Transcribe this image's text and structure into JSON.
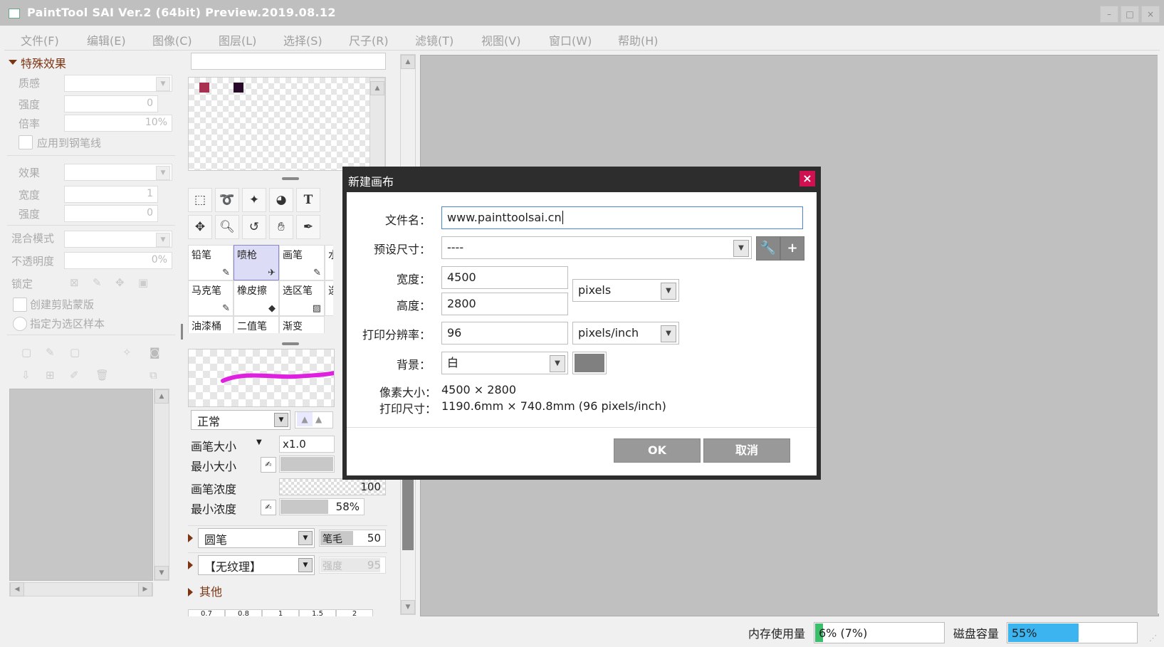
{
  "window": {
    "title": "PaintTool SAI Ver.2 (64bit) Preview.2019.08.12"
  },
  "menu": [
    "文件(F)",
    "编辑(E)",
    "图像(C)",
    "图层(L)",
    "选择(S)",
    "尺子(R)",
    "滤镜(T)",
    "视图(V)",
    "窗口(W)",
    "帮助(H)"
  ],
  "effects_panel": {
    "header": "特殊效果",
    "texture_label": "质感",
    "strength_label": "强度",
    "strength_value": "0",
    "ratio_label": "倍率",
    "ratio_value": "10%",
    "apply_pen_label": "应用到钢笔线",
    "effect_label": "效果",
    "width_label": "宽度",
    "width_value": "1",
    "strength2_label": "强度",
    "strength2_value": "0"
  },
  "layer_panel": {
    "blend_label": "混合模式",
    "opacity_label": "不透明度",
    "opacity_value": "0%",
    "lock_label": "锁定",
    "clip_label": "创建剪贴蒙版",
    "sample_label": "指定为选区样本"
  },
  "colors": {
    "swatch1": "#a83050",
    "swatch2": "#2a0a2a",
    "stroke": "#e020e0",
    "accent_close": "#d01050",
    "memory_fill": "#3cbf6a",
    "disk_fill": "#3cb4f0"
  },
  "tools": {
    "row1": [
      "rect-select-icon",
      "lasso-icon",
      "magic-wand-icon",
      "fill-shape-icon",
      "text-icon"
    ],
    "row2": [
      "move-icon",
      "zoom-icon",
      "rotate-icon",
      "hand-icon",
      "eyedropper-icon"
    ],
    "text_glyph": "T"
  },
  "brushes": [
    {
      "name": "铅笔",
      "icon": "✎"
    },
    {
      "name": "喷枪",
      "icon": "✈"
    },
    {
      "name": "画笔",
      "icon": "✎"
    },
    {
      "name": "水"
    },
    {
      "name": "马克笔",
      "icon": "✎"
    },
    {
      "name": "橡皮擦",
      "icon": "◆"
    },
    {
      "name": "选区笔",
      "icon": "▨"
    },
    {
      "name": "选"
    },
    {
      "name": "油漆桶"
    },
    {
      "name": "二值笔"
    },
    {
      "name": "渐变"
    }
  ],
  "brush_settings": {
    "mode": "正常",
    "size_label": "画笔大小",
    "size_mult": "x1.0",
    "min_size_label": "最小大小",
    "density_label": "画笔浓度",
    "density_value": "100",
    "min_density_label": "最小浓度",
    "min_density_value": "58%",
    "min_density_fraction": 0.58,
    "shape": "圆笔",
    "bristle_label": "笔毛",
    "bristle_value": "50",
    "texture": "【无纹理】",
    "texture_strength_label": "强度",
    "texture_strength_value": "95",
    "other_label": "其他",
    "bottom_sizes": [
      "0.7",
      "0.8",
      "1",
      "1.5",
      "2"
    ]
  },
  "dialog": {
    "title": "新建画布",
    "close_glyph": "×",
    "filename_label": "文件名：",
    "filename_value": "www.painttoolsai.cn",
    "preset_label": "预设尺寸：",
    "preset_value": "----",
    "width_label": "宽度：",
    "width_value": "4500",
    "height_label": "高度：",
    "height_value": "2800",
    "unit_value": "pixels",
    "dpi_label": "打印分辨率：",
    "dpi_value": "96",
    "dpi_unit": "pixels/inch",
    "bg_label": "背景：",
    "bg_value": "白",
    "bg_color": "#808080",
    "pixel_size_label": "像素大小：",
    "pixel_size_value": "4500 × 2800",
    "print_size_label": "打印尺寸：",
    "print_size_value": "1190.6mm × 740.8mm (96 pixels/inch)",
    "ok_label": "OK",
    "cancel_label": "取消",
    "wrench_glyph": "🔧",
    "plus_glyph": "+"
  },
  "status": {
    "memory_label": "内存使用量",
    "memory_value": "6% (7%)",
    "memory_fraction": 0.06,
    "disk_label": "磁盘容量",
    "disk_value": "55%",
    "disk_fraction": 0.55
  }
}
